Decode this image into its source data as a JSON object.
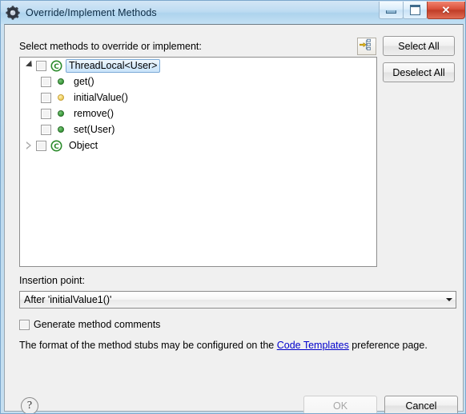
{
  "window": {
    "title": "Override/Implement Methods",
    "title_icon": "gear-icon",
    "controls": {
      "minimize": "minimize-icon",
      "maximize": "maximize-icon",
      "close": "✕"
    }
  },
  "list_label": "Select methods to override or implement:",
  "toolbar": {
    "link_button_icon": "show-in-hierarchy-icon"
  },
  "buttons": {
    "select_all": "Select All",
    "deselect_all": "Deselect All",
    "ok": "OK",
    "cancel": "Cancel",
    "help": "?"
  },
  "tree": [
    {
      "label": "ThreadLocal<User>",
      "icon": "java-class-icon",
      "depth": 0,
      "twisty": "expanded",
      "checked": false,
      "selected": true
    },
    {
      "label": "get()",
      "icon": "public-method-icon",
      "depth": 1,
      "twisty": "none",
      "checked": false,
      "selected": false
    },
    {
      "label": "initialValue()",
      "icon": "protected-method-icon",
      "depth": 1,
      "twisty": "none",
      "checked": false,
      "selected": false
    },
    {
      "label": "remove()",
      "icon": "public-method-icon",
      "depth": 1,
      "twisty": "none",
      "checked": false,
      "selected": false
    },
    {
      "label": "set(User)",
      "icon": "public-method-icon",
      "depth": 1,
      "twisty": "none",
      "checked": false,
      "selected": false
    },
    {
      "label": "Object",
      "icon": "java-class-icon",
      "depth": 0,
      "twisty": "collapsed",
      "checked": false,
      "selected": false
    }
  ],
  "insertion_point": {
    "label": "Insertion point:",
    "value": "After 'initialValue1()'"
  },
  "generate_comments": {
    "label": "Generate method comments",
    "checked": false
  },
  "hint": {
    "before": "The format of the method stubs may be configured on the ",
    "link": "Code Templates",
    "after": " preference page."
  },
  "colors": {
    "titlebar": "#bedcf2",
    "dialog_background": "#f0f0f0",
    "selection": "#cbe4fa",
    "link": "#0000cc",
    "public_method": "#3f9f3f",
    "protected_method": "#f2d469",
    "close_button": "#d9503a"
  }
}
